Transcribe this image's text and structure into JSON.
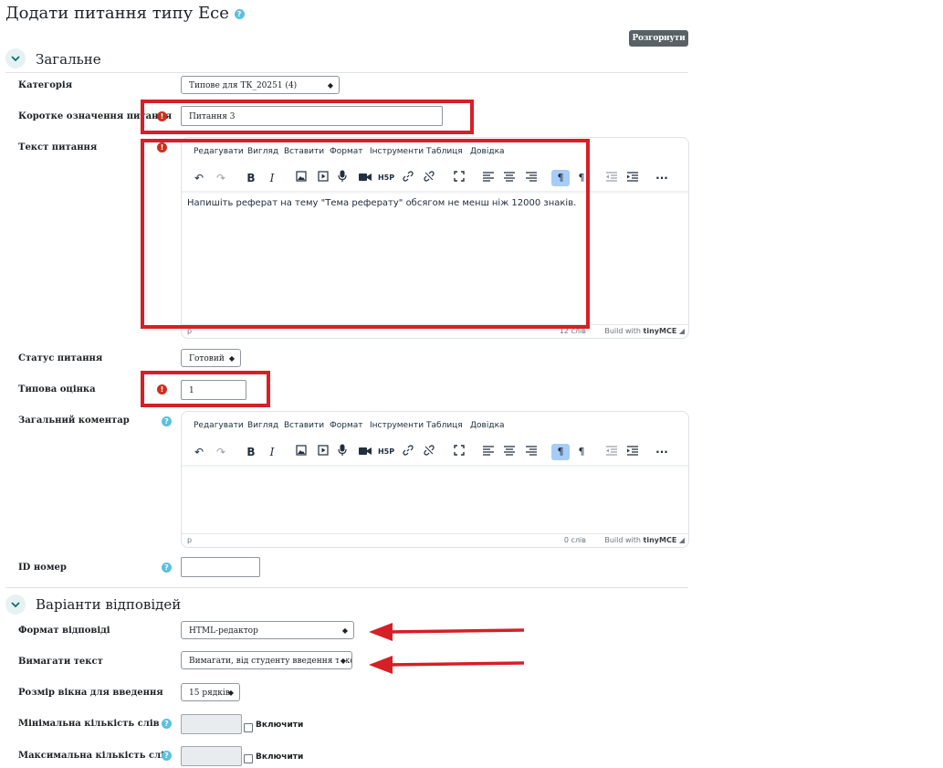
{
  "page": {
    "title": "Додати питання типу Есе",
    "expand_all": "Розгорнути всі"
  },
  "sections": {
    "general": "Загальне",
    "responses": "Варіанти відповідей"
  },
  "fields": {
    "category": {
      "label": "Категорія",
      "value": "Типове для ТК_20251 (4)"
    },
    "name": {
      "label": "Коротке означення питання",
      "value": "Питання 3"
    },
    "text": {
      "label": "Текст питання"
    },
    "status": {
      "label": "Статус питання",
      "value": "Готовий"
    },
    "mark": {
      "label": "Типова оцінка",
      "value": "1"
    },
    "feedback": {
      "label": "Загальний коментар"
    },
    "idnumber": {
      "label": "ID номер",
      "value": ""
    },
    "format": {
      "label": "Формат відповіді",
      "value": "HTML-редактор"
    },
    "required": {
      "label": "Вимагати текст",
      "value": "Вимагати, від студенту введення тексту"
    },
    "boxsize": {
      "label": "Розмір вікна для введення",
      "value": "15 рядків"
    },
    "minwords": {
      "label": "Мінімальна кількість слів",
      "enable": "Включити"
    },
    "maxwords": {
      "label": "Максимальна кількість слів",
      "enable": "Включити"
    }
  },
  "editor_menu": [
    "Редагувати",
    "Вигляд",
    "Вставити",
    "Формат",
    "Інструменти",
    "Таблиця",
    "Довідка"
  ],
  "editor1": {
    "content": "Напишіть реферат на тему \"Тема реферату\" обсягом не менш ніж 12000 знаків.",
    "path": "p",
    "words": "12 слів",
    "build": "Build with",
    "brand": "tinyMCE"
  },
  "editor2": {
    "content": "",
    "path": "p",
    "words": "0 слів",
    "build": "Build with",
    "brand": "tinyMCE"
  },
  "icons": {
    "help": "?",
    "error": "!"
  },
  "colors": {
    "annotation_red": "#d61f26",
    "error_red": "#ca3120",
    "help_blue": "#5bc0de",
    "button_gray": "#596166",
    "active_toolbar": "#a6ccf7"
  }
}
